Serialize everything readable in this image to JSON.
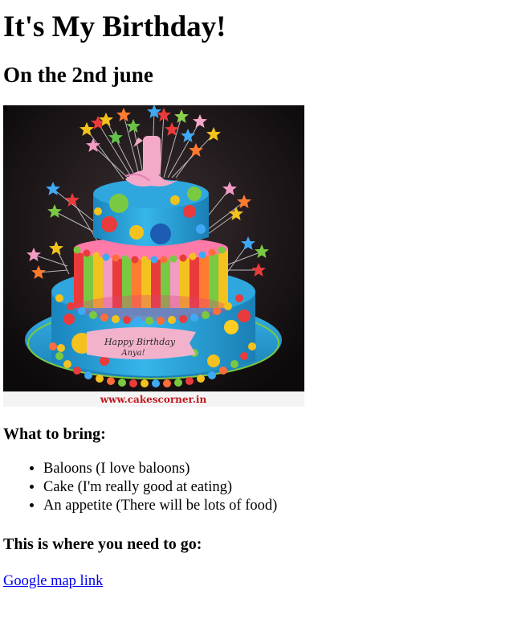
{
  "page": {
    "title": "It's My Birthday!",
    "subtitle": "On the 2nd june"
  },
  "image": {
    "watermark": "www.cakescorner.in",
    "plaque_text_line1": "Happy Birthday",
    "plaque_text_line2": "Anya!",
    "topper_number": "1",
    "colors": {
      "background": "#151112",
      "fondant_blue": "#29a8df",
      "plaque_pink": "#f2b2cc"
    }
  },
  "bring": {
    "heading": "What to bring:",
    "items": [
      "Baloons (I love baloons)",
      "Cake (I'm really good at eating)",
      "An appetite (There will be lots of food)"
    ]
  },
  "directions": {
    "heading": "This is where you need to go:",
    "link_label": "Google map link"
  }
}
